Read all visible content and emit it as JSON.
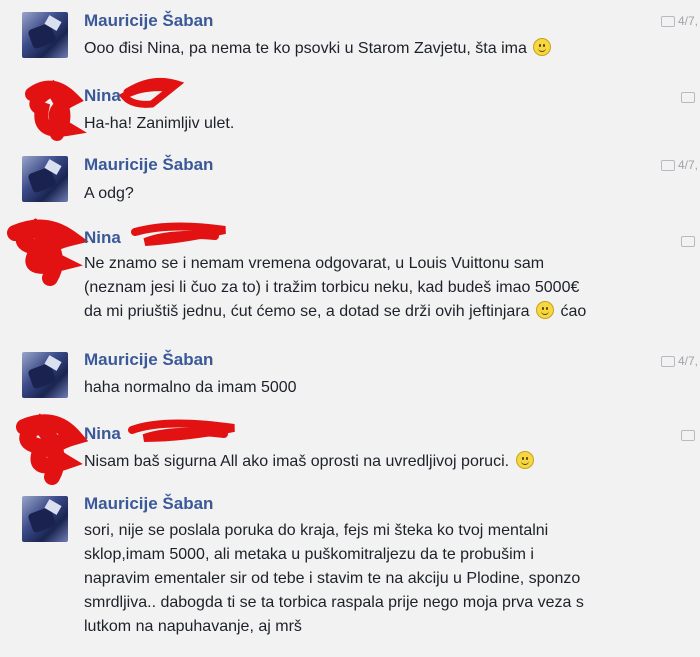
{
  "colors": {
    "name": "#3b5998",
    "text": "#1d2129",
    "redaction": "#e31212",
    "background": "#f2f2f2"
  },
  "messages": [
    {
      "sender": "Mauricije Šaban",
      "meta": "4/7,",
      "text": "Ooo đisi Nina, pa nema te ko psovki u Starom Zavjetu, šta ima",
      "has_smiley": true
    },
    {
      "sender": "Nina",
      "meta": "",
      "text": "Ha-ha! Zanimljiv ulet.",
      "has_smiley": false
    },
    {
      "sender": "Mauricije Šaban",
      "meta": "4/7,",
      "text": "A odg?",
      "has_smiley": false
    },
    {
      "sender": "Nina",
      "meta": "",
      "lines": [
        "Ne znamo se i nemam vremena odgovarat, u Louis Vuittonu sam",
        "(neznam jesi li čuo za to) i tražim torbicu neku, kad budeš imao 5000€",
        "da mi priuštiš jednu, ćut ćemo se, a dotad se drži ovih jeftinjara",
        "ćao"
      ],
      "has_smiley": true
    },
    {
      "sender": "Mauricije Šaban",
      "meta": "4/7,",
      "text": "haha normalno da imam 5000",
      "has_smiley": false
    },
    {
      "sender": "Nina",
      "meta": "",
      "text": "Nisam baš sigurna  All ako imaš oprosti na uvredljivoj poruci.",
      "has_smiley": true
    },
    {
      "sender": "Mauricije Šaban",
      "meta": "",
      "lines": [
        "sori, nije se poslala poruka do kraja, fejs mi šteka ko tvoj mentalni",
        "sklop,imam 5000, ali metaka u puškomitraljezu  da te probušim i",
        "napravim ementaler sir od tebe i stavim te na akciju u Plodine, sponzo",
        "smrdljiva.. dabogda ti se ta torbica raspala prije nego moja prva veza s",
        "lutkom na napuhavanje, aj mrš"
      ],
      "has_smiley": false
    }
  ]
}
